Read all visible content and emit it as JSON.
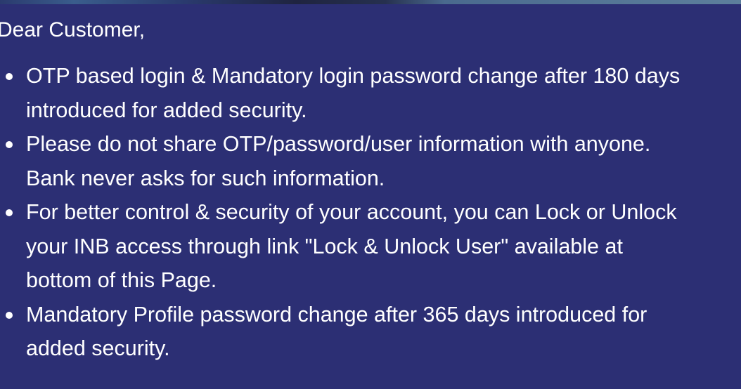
{
  "notice": {
    "greeting": "Dear Customer,",
    "points": [
      "OTP based login & Mandatory login password change after 180 days introduced for added security.",
      "Please do not share OTP/password/user information with anyone. Bank never asks for such information.",
      "For better control & security of your account, you can Lock or Unlock your INB access through link \"Lock & Unlock User\" available at bottom of this Page.",
      "Mandatory Profile password change after 365 days introduced for added security."
    ]
  },
  "colors": {
    "background": "#2c2f74",
    "text": "#ffffff"
  }
}
